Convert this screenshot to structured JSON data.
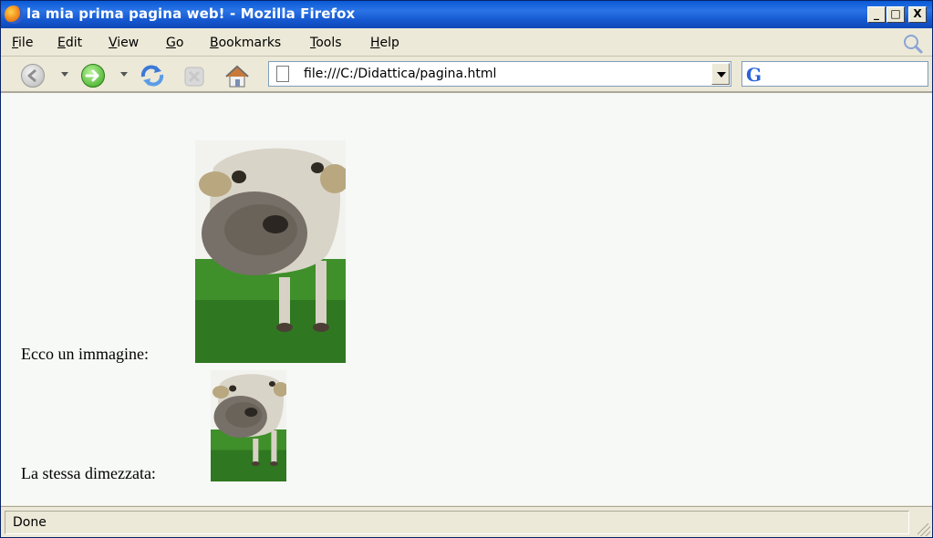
{
  "window": {
    "title": "la mia prima pagina web! - Mozilla Firefox",
    "min_label": "_",
    "max_label": "□",
    "close_label": "X"
  },
  "menu": {
    "items": [
      {
        "label": "File",
        "accel": "F",
        "rest": "ile"
      },
      {
        "label": "Edit",
        "accel": "E",
        "rest": "dit"
      },
      {
        "label": "View",
        "accel": "V",
        "rest": "iew"
      },
      {
        "label": "Go",
        "accel": "G",
        "rest": "o"
      },
      {
        "label": "Bookmarks",
        "accel": "B",
        "rest": "ookmarks"
      },
      {
        "label": "Tools",
        "accel": "T",
        "rest": "ools"
      },
      {
        "label": "Help",
        "accel": "H",
        "rest": "elp"
      }
    ]
  },
  "toolbar": {
    "icons": [
      "back-icon",
      "forward-icon",
      "reload-icon",
      "stop-icon",
      "home-icon"
    ]
  },
  "address": {
    "url": "file:///C:/Didattica/pagina.html"
  },
  "search": {
    "engine_letter": "G",
    "value": ""
  },
  "content": {
    "line1_label": "Ecco un immagine:",
    "line2_label": "La stessa dimezzata:",
    "image_scale_second": 0.5
  },
  "status": {
    "text": "Done"
  },
  "colors": {
    "titlebar": "#0a5ad6",
    "chrome": "#ece9d8",
    "content_bg": "#f7f9f6",
    "forward_green": "#33a61a"
  }
}
